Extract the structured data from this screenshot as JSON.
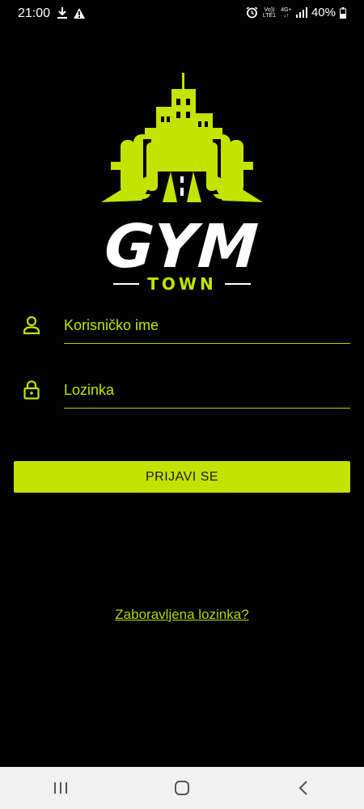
{
  "status_bar": {
    "time": "21:00",
    "left_icons": [
      "download-icon",
      "warning-icon"
    ],
    "right_icons": [
      "alarm-icon",
      "volte-icon",
      "4g-icon",
      "signal-icon",
      "battery-icon"
    ],
    "volte_label": "Vo))\nLTE1",
    "network_label": "4G+",
    "battery": "40%"
  },
  "logo": {
    "word": "GYM",
    "sub": "TOWN"
  },
  "form": {
    "username": {
      "placeholder": "Korisničko ime",
      "value": "",
      "icon": "person-icon"
    },
    "password": {
      "placeholder": "Lozinka",
      "value": "",
      "icon": "lock-icon"
    },
    "login_label": "PRIJAVI SE",
    "forgot_label": "Zaboravljena lozinka?"
  },
  "nav_bar": {
    "items": [
      "recent-apps-icon",
      "home-icon",
      "back-icon"
    ]
  },
  "colors": {
    "background": "#020202",
    "accent": "#c3e300",
    "text_light": "#ffffff",
    "nav_background": "#f1f1f1"
  }
}
